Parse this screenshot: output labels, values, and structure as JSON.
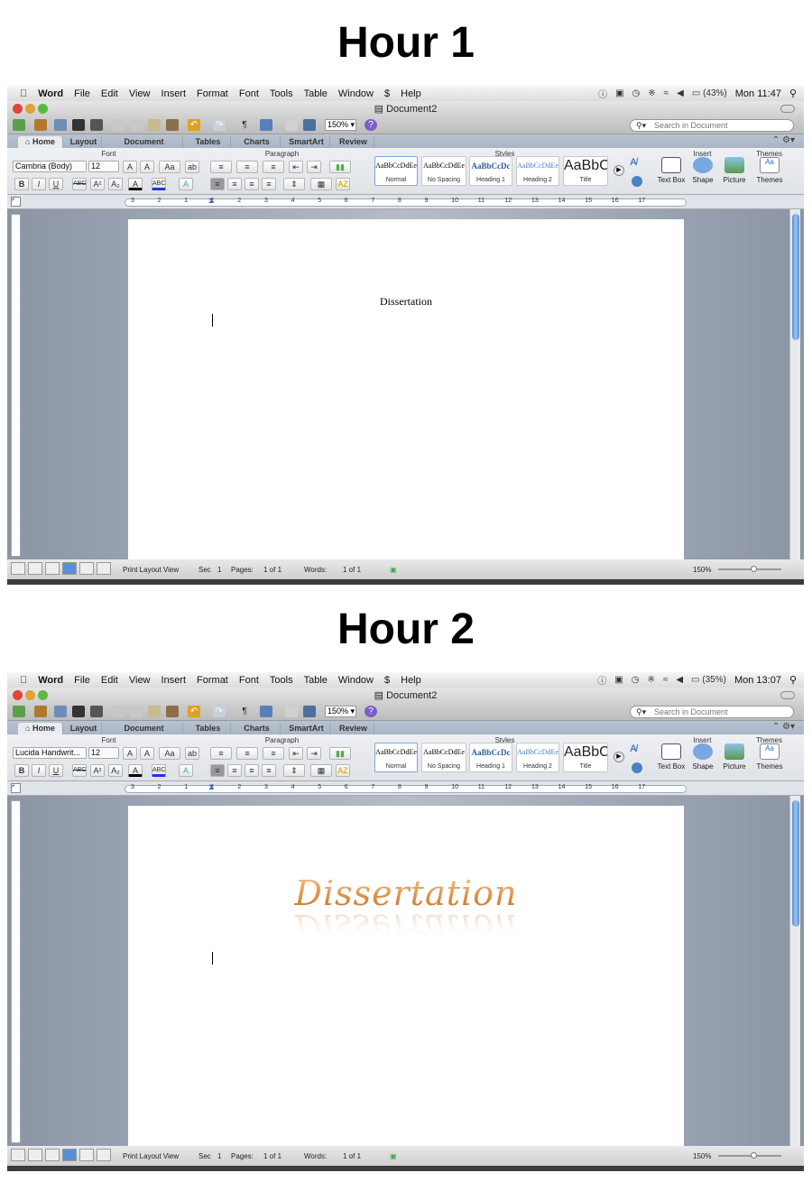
{
  "app": {
    "apple_icon": "apple-icon",
    "app_name": "Word",
    "menus": [
      "File",
      "Edit",
      "View",
      "Insert",
      "Format",
      "Font",
      "Tools",
      "Table",
      "Window",
      "$",
      "Help"
    ],
    "doc_title": "Document2",
    "zoom": "150%",
    "search_placeholder": "Search in Document",
    "tabs": [
      "Home",
      "Layout",
      "Document Elements",
      "Tables",
      "Charts",
      "SmartArt",
      "Review"
    ],
    "groups": {
      "font": "Font",
      "paragraph": "Paragraph",
      "styles": "Styles",
      "insert": "Insert",
      "themes": "Themes"
    },
    "font_size": "12",
    "styles": [
      {
        "preview": "AaBbCcDdEe",
        "name": "Normal"
      },
      {
        "preview": "AaBbCcDdEe",
        "name": "No Spacing"
      },
      {
        "preview": "AaBbCcDc",
        "name": "Heading 1"
      },
      {
        "preview": "AaBbCcDdEe",
        "name": "Heading 2"
      },
      {
        "preview": "AaBbC",
        "name": "Title"
      }
    ],
    "insert": [
      "Text Box",
      "Shape",
      "Picture"
    ],
    "themes_label": "Themes",
    "ruler_numbers": [
      "3",
      "2",
      "1",
      "1",
      "2",
      "3",
      "4",
      "5",
      "6",
      "7",
      "8",
      "9",
      "10",
      "11",
      "12",
      "13",
      "14",
      "15",
      "16",
      "17"
    ],
    "status": {
      "view": "Print Layout View",
      "sec_label": "Sec",
      "sec": "1",
      "pages_label": "Pages:",
      "pages": "1 of 1",
      "words_label": "Words:",
      "words": "1 of 1",
      "zoom": "150%"
    },
    "colors": {
      "accent": "#5a8fd6",
      "wordart": "#d98a2a"
    }
  },
  "windows": [
    {
      "heading": "Hour 1",
      "battery": "(43%)",
      "clock": "Mon 11:47",
      "font_name": "Cambria (Body)",
      "doc_text": "Dissertation",
      "style": "plain"
    },
    {
      "heading": "Hour 2",
      "battery": "(35%)",
      "clock": "Mon 13:07",
      "font_name": "Lucida Handwrit...",
      "doc_text": "Dissertation",
      "style": "wordart-with-reflection"
    }
  ]
}
